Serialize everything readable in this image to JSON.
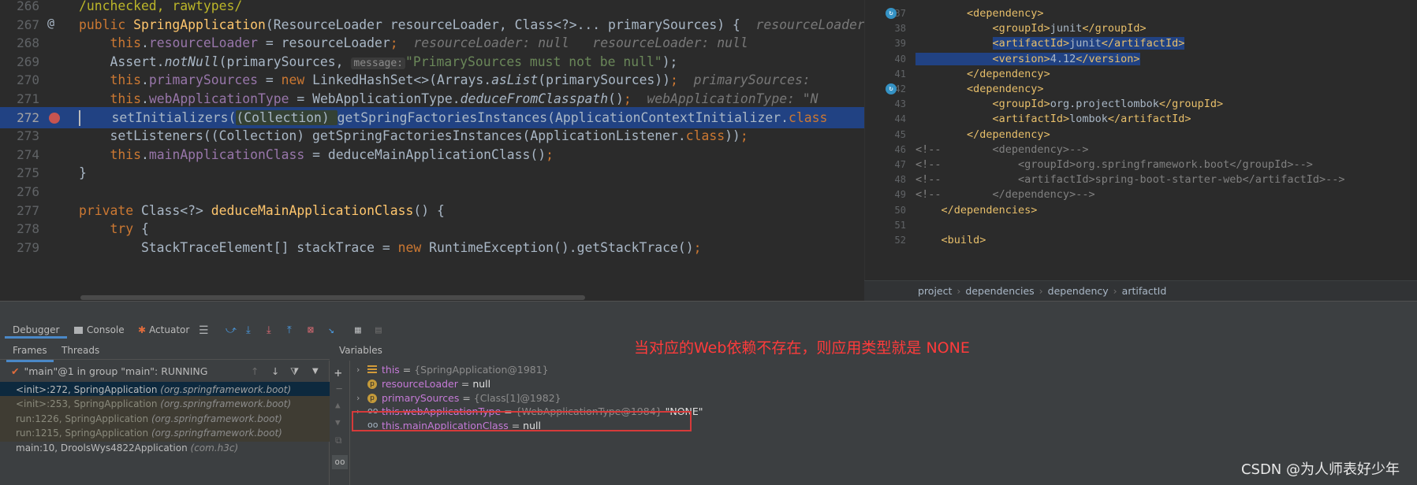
{
  "editor_left": {
    "lines": [
      {
        "num": "266",
        "code": [
          {
            "t": "/unchecked, rawtypes/",
            "c": "ann"
          }
        ]
      },
      {
        "num": "267",
        "marker": "@",
        "code": [
          {
            "t": "public ",
            "c": "kw"
          },
          {
            "t": "SpringApplication",
            "c": "fn"
          },
          {
            "t": "(ResourceLoader resourceLoader, Class<?>... primarySources) {  "
          },
          {
            "t": "resourceLoader: null",
            "c": "hint"
          }
        ]
      },
      {
        "num": "268",
        "code": [
          {
            "t": "    "
          },
          {
            "t": "this",
            "c": "kw"
          },
          {
            "t": "."
          },
          {
            "t": "resourceLoader",
            "c": "fld"
          },
          {
            "t": " = resourceLoader"
          },
          {
            "t": ";",
            "c": "kw"
          },
          {
            "t": "  resourceLoader: null   resourceLoader: null",
            "c": "hint"
          }
        ]
      },
      {
        "num": "269",
        "code": [
          {
            "t": "    Assert."
          },
          {
            "t": "notNull",
            "c": "it"
          },
          {
            "t": "(primarySources, "
          },
          {
            "t": "message:",
            "c": "hintbox"
          },
          {
            "t": "\"PrimarySources must not be null\"",
            "c": "str"
          },
          {
            "t": ");"
          }
        ]
      },
      {
        "num": "270",
        "code": [
          {
            "t": "    "
          },
          {
            "t": "this",
            "c": "kw"
          },
          {
            "t": "."
          },
          {
            "t": "primarySources",
            "c": "fld"
          },
          {
            "t": " = "
          },
          {
            "t": "new ",
            "c": "kw"
          },
          {
            "t": "LinkedHashSet<>(Arrays."
          },
          {
            "t": "asList",
            "c": "it"
          },
          {
            "t": "(primarySources))"
          },
          {
            "t": ";",
            "c": "kw"
          },
          {
            "t": "  primarySources: ",
            "c": "hint"
          }
        ]
      },
      {
        "num": "271",
        "code": [
          {
            "t": "    "
          },
          {
            "t": "this",
            "c": "kw"
          },
          {
            "t": "."
          },
          {
            "t": "webApplicationType",
            "c": "fld"
          },
          {
            "t": " = WebApplicationType."
          },
          {
            "t": "deduceFromClasspath",
            "c": "it"
          },
          {
            "t": "()"
          },
          {
            "t": ";",
            "c": "kw"
          },
          {
            "t": "  webApplicationType: \"N",
            "c": "hint"
          }
        ]
      },
      {
        "num": "272",
        "highlight": true,
        "breakpoint": true,
        "code": [
          {
            "t": "    setInitializers("
          },
          {
            "t": "(Collection) ",
            "c": "cast"
          },
          {
            "t": "getSpringFactoriesInstances(ApplicationContextInitializer."
          },
          {
            "t": "class",
            "c": "kw"
          }
        ]
      },
      {
        "num": "273",
        "code": [
          {
            "t": "    setListeners((Collection) getSpringFactoriesInstances(ApplicationListener."
          },
          {
            "t": "class",
            "c": "kw"
          },
          {
            "t": "))"
          },
          {
            "t": ";",
            "c": "kw"
          }
        ]
      },
      {
        "num": "274",
        "code": [
          {
            "t": "    "
          },
          {
            "t": "this",
            "c": "kw"
          },
          {
            "t": "."
          },
          {
            "t": "mainApplicationClass",
            "c": "fld"
          },
          {
            "t": " = deduceMainApplicationClass()"
          },
          {
            "t": ";",
            "c": "kw"
          }
        ]
      },
      {
        "num": "275",
        "code": [
          {
            "t": "}"
          }
        ]
      },
      {
        "num": "276",
        "code": []
      },
      {
        "num": "277",
        "code": [
          {
            "t": "private ",
            "c": "kw"
          },
          {
            "t": "Class<?> "
          },
          {
            "t": "deduceMainApplicationClass",
            "c": "fn"
          },
          {
            "t": "() {"
          }
        ]
      },
      {
        "num": "278",
        "code": [
          {
            "t": "    "
          },
          {
            "t": "try ",
            "c": "kw"
          },
          {
            "t": "{"
          }
        ]
      },
      {
        "num": "279",
        "code": [
          {
            "t": "        StackTraceElement[] stackTrace = "
          },
          {
            "t": "new ",
            "c": "kw"
          },
          {
            "t": "RuntimeException().getStackTrace()"
          },
          {
            "t": ";",
            "c": "kw"
          }
        ]
      }
    ]
  },
  "editor_right": {
    "lines": [
      {
        "num": "37",
        "icon": true,
        "code": [
          {
            "t": "        "
          },
          {
            "t": "<dependency>",
            "c": "xt"
          }
        ]
      },
      {
        "num": "38",
        "code": [
          {
            "t": "            "
          },
          {
            "t": "<groupId>",
            "c": "xt"
          },
          {
            "t": "junit"
          },
          {
            "t": "</groupId>",
            "c": "xt"
          }
        ]
      },
      {
        "num": "39",
        "code": [
          {
            "t": "            "
          },
          {
            "t": "<artifactId>",
            "c": "xt xml-sel"
          },
          {
            "t": "junit",
            "c": "xml-sel"
          },
          {
            "t": "</artifactId>",
            "c": "xt xml-sel"
          }
        ]
      },
      {
        "num": "40",
        "code": [
          {
            "t": "            ",
            "c": "xml-sel"
          },
          {
            "t": "<version>",
            "c": "xt xml-sel"
          },
          {
            "t": "4.12",
            "c": "xml-sel"
          },
          {
            "t": "</version>",
            "c": "xt xml-sel"
          }
        ]
      },
      {
        "num": "41",
        "code": [
          {
            "t": "        "
          },
          {
            "t": "</dependency>",
            "c": "xt"
          }
        ]
      },
      {
        "num": "42",
        "icon": true,
        "code": [
          {
            "t": "        "
          },
          {
            "t": "<dependency>",
            "c": "xt"
          }
        ]
      },
      {
        "num": "43",
        "code": [
          {
            "t": "            "
          },
          {
            "t": "<groupId>",
            "c": "xt"
          },
          {
            "t": "org.projectlombok"
          },
          {
            "t": "</groupId>",
            "c": "xt"
          }
        ]
      },
      {
        "num": "44",
        "code": [
          {
            "t": "            "
          },
          {
            "t": "<artifactId>",
            "c": "xt"
          },
          {
            "t": "lombok"
          },
          {
            "t": "</artifactId>",
            "c": "xt"
          }
        ]
      },
      {
        "num": "45",
        "code": [
          {
            "t": "        "
          },
          {
            "t": "</dependency>",
            "c": "xt"
          }
        ]
      },
      {
        "num": "46",
        "code": [
          {
            "t": "<!--        <dependency>-->",
            "c": "cm"
          }
        ]
      },
      {
        "num": "47",
        "code": [
          {
            "t": "<!--            <groupId>org.springframework.boot</groupId>-->",
            "c": "cm"
          }
        ]
      },
      {
        "num": "48",
        "code": [
          {
            "t": "<!--            <artifactId>spring-boot-starter-web</artifactId>-->",
            "c": "cm"
          }
        ]
      },
      {
        "num": "49",
        "code": [
          {
            "t": "<!--        </dependency>-->",
            "c": "cm"
          }
        ]
      },
      {
        "num": "50",
        "code": [
          {
            "t": "    "
          },
          {
            "t": "</dependencies>",
            "c": "xt"
          }
        ]
      },
      {
        "num": "51",
        "code": []
      },
      {
        "num": "52",
        "code": [
          {
            "t": "    "
          },
          {
            "t": "<build>",
            "c": "xt"
          }
        ]
      }
    ]
  },
  "breadcrumb": [
    "project",
    "dependencies",
    "dependency",
    "artifactId"
  ],
  "debugger": {
    "tabs": {
      "debugger": "Debugger",
      "console": "Console",
      "actuator": "Actuator"
    },
    "subtabs": {
      "frames": "Frames",
      "threads": "Threads"
    },
    "variables_title": "Variables",
    "thread": "\"main\"@1 in group \"main\": RUNNING",
    "frames": [
      {
        "method": "<init>:272, SpringApplication",
        "pkg": "(org.springframework.boot)",
        "state": "sel"
      },
      {
        "method": "<init>:253, SpringApplication",
        "pkg": "(org.springframework.boot)",
        "state": "lib"
      },
      {
        "method": "run:1226, SpringApplication",
        "pkg": "(org.springframework.boot)",
        "state": "lib"
      },
      {
        "method": "run:1215, SpringApplication",
        "pkg": "(org.springframework.boot)",
        "state": "lib"
      },
      {
        "method": "main:10, DroolsWys4822Application",
        "pkg": "(com.h3c)",
        "state": ""
      }
    ],
    "variables": [
      {
        "name": "this",
        "eq": " = ",
        "val": "{SpringApplication@1981}",
        "str": "",
        "icon": "lines",
        "arrow": true
      },
      {
        "name": "resourceLoader",
        "eq": " = ",
        "val": "",
        "str": "null",
        "icon": "p",
        "arrow": false
      },
      {
        "name": "primarySources",
        "eq": " = ",
        "val": "{Class[1]@1982}",
        "str": "",
        "icon": "p",
        "arrow": true
      },
      {
        "name": "this.webApplicationType",
        "eq": " = ",
        "val": "{WebApplicationType@1984}",
        "str": " \"NONE\"",
        "icon": "watch",
        "arrow": true
      },
      {
        "name": "this.mainApplicationClass",
        "eq": " = ",
        "val": "",
        "str": "null",
        "icon": "watch",
        "arrow": false
      }
    ]
  },
  "annotation": "当对应的Web依赖不存在，则应用类型就是 NONE",
  "watermark": "CSDN @为人师表好少年",
  "colors": {
    "highlight_box": "#d63a3a",
    "annotation": "#ff3b3b"
  }
}
